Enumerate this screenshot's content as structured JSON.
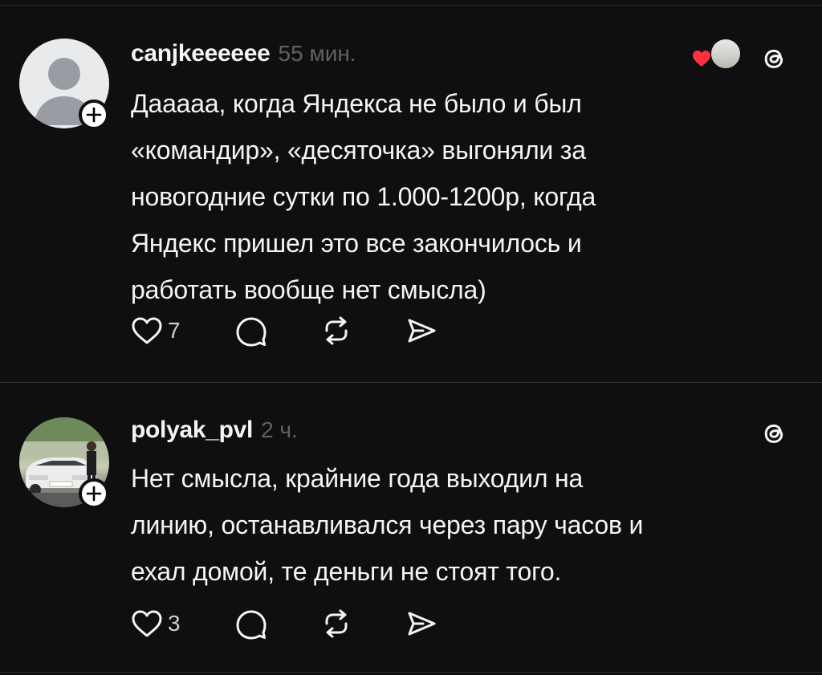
{
  "posts": [
    {
      "username": "canjkeeeeee",
      "time": "55 мин.",
      "text": "Дааааа, когда Яндекса не было и был\n«командир», «десяточка» выгоняли за\nновогодние сутки по 1.000-1200р, когда\nЯндекс пришел это все закончилось и\nработать вообще нет смысла)",
      "like_count": "7",
      "avatar": "default-avatar-icon",
      "liked_by_author": true
    },
    {
      "username": "polyak_pvl",
      "time": "2 ч.",
      "text": "Нет смысла, крайние года выходил на\nлинию, останавливался через пару часов и\nехал домой, те деньги не стоят того.",
      "like_count": "3",
      "avatar": "photo-avatar"
    }
  ],
  "colors": {
    "background": "#0f0f0f",
    "text": "#f3f5f7",
    "muted": "#616161",
    "heart": "#ff3040"
  },
  "icons": [
    "heart-icon",
    "comment-icon",
    "repost-icon",
    "share-icon",
    "threads-logo-icon",
    "plus-icon"
  ]
}
